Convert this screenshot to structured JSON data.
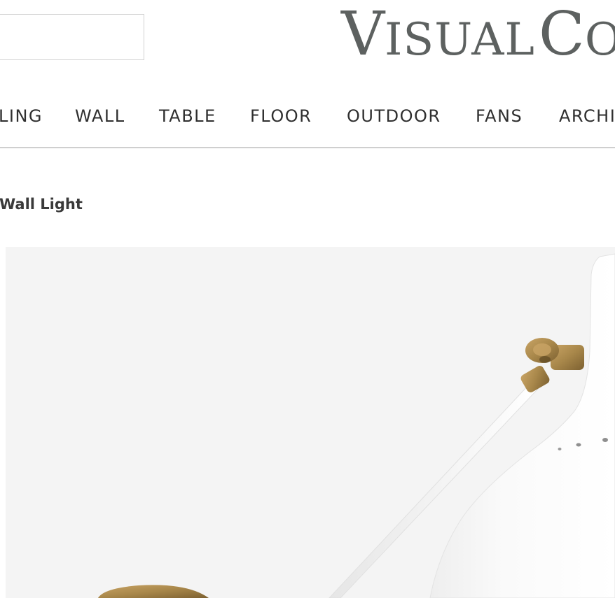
{
  "search": {
    "placeholder": "",
    "value": ""
  },
  "logo": {
    "initial_v": "V",
    "rest_v": "ISUAL",
    "initial_c": "C",
    "rest_c": "O"
  },
  "nav": {
    "items": [
      {
        "label": "LING"
      },
      {
        "label": "WALL"
      },
      {
        "label": "TABLE"
      },
      {
        "label": "FLOOR"
      },
      {
        "label": "OUTDOOR"
      },
      {
        "label": "FANS"
      },
      {
        "label": "ARCHI"
      }
    ]
  },
  "product": {
    "title": "Wall Light"
  },
  "colors": {
    "brass": "#a8874a",
    "shade": "#f9f9f9",
    "background": "#f4f4f4",
    "logo": "#5d6160"
  }
}
